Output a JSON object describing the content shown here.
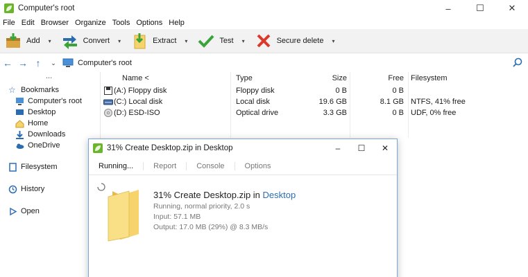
{
  "window": {
    "title": "Computer's root",
    "minimize": "–",
    "maximize": "☐",
    "close": "✕"
  },
  "menu": [
    "File",
    "Edit",
    "Browser",
    "Organize",
    "Tools",
    "Options",
    "Help"
  ],
  "toolbar": {
    "add": "Add",
    "convert": "Convert",
    "extract": "Extract",
    "test": "Test",
    "secure_delete": "Secure delete",
    "dropdown": "▾"
  },
  "address": {
    "path": "Computer's root"
  },
  "sidebar": {
    "dots": "...",
    "bookmarks": "Bookmarks",
    "items": [
      "Computer's root",
      "Desktop",
      "Home",
      "Downloads",
      "OneDrive"
    ],
    "filesystem": "Filesystem",
    "history": "History",
    "open": "Open"
  },
  "files": {
    "headers": {
      "name": "Name <",
      "type": "Type",
      "size": "Size",
      "free": "Free",
      "filesystem": "Filesystem"
    },
    "rows": [
      {
        "name": "(A:) Floppy disk",
        "type": "Floppy disk",
        "size": "0 B",
        "free": "0 B",
        "fs": ""
      },
      {
        "name": "(C:) Local disk",
        "type": "Local disk",
        "size": "19.6 GB",
        "free": "8.1 GB",
        "fs": "NTFS, 41% free"
      },
      {
        "name": "(D:) ESD-ISO",
        "type": "Optical drive",
        "size": "3.3 GB",
        "free": "0 B",
        "fs": "UDF, 0% free"
      }
    ]
  },
  "dialog": {
    "title": "31% Create Desktop.zip in Desktop",
    "tabs": [
      "Running...",
      "Report",
      "Console",
      "Options"
    ],
    "heading_prefix": "31% Create Desktop.zip in ",
    "heading_link": "Desktop",
    "status": "Running, normal priority, 2.0 s",
    "input": "Input: 57.1 MB",
    "output": "Output: 17.0 MB (29%) @ 8.3 MB/s",
    "progress_percent": 31
  },
  "colors": {
    "accent": "#2b6cb0",
    "leaf": "#6bb52b",
    "folder": "#f6d36b",
    "red": "#d83b2b",
    "green": "#3aa33a"
  }
}
